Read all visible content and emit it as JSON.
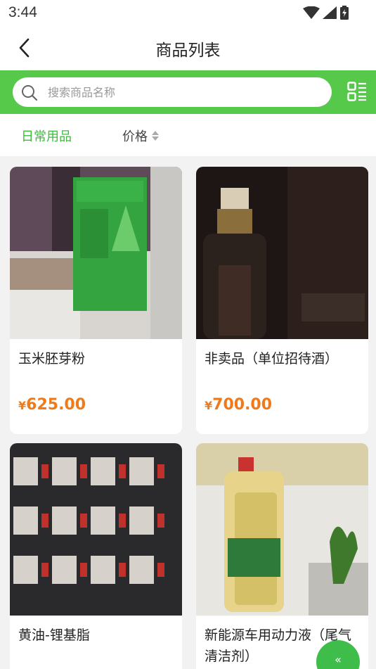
{
  "status_bar": {
    "time": "3:44"
  },
  "nav": {
    "title": "商品列表"
  },
  "search": {
    "placeholder": "搜索商品名称"
  },
  "filters": {
    "category": "日常用品",
    "price": "价格"
  },
  "products": [
    {
      "name": "玉米胚芽粉",
      "currency": "¥",
      "price": "625.00"
    },
    {
      "name": "非卖品（单位招待酒）",
      "currency": "¥",
      "price": "700.00"
    },
    {
      "name": "黄油-锂基脂"
    },
    {
      "name": "新能源车用动力液（尾气清洁剂）"
    }
  ],
  "float_button": {
    "label": "«"
  },
  "colors": {
    "brand_green": "#56c84a",
    "price_orange": "#f07a1a",
    "filter_active": "#3dbb3d"
  }
}
